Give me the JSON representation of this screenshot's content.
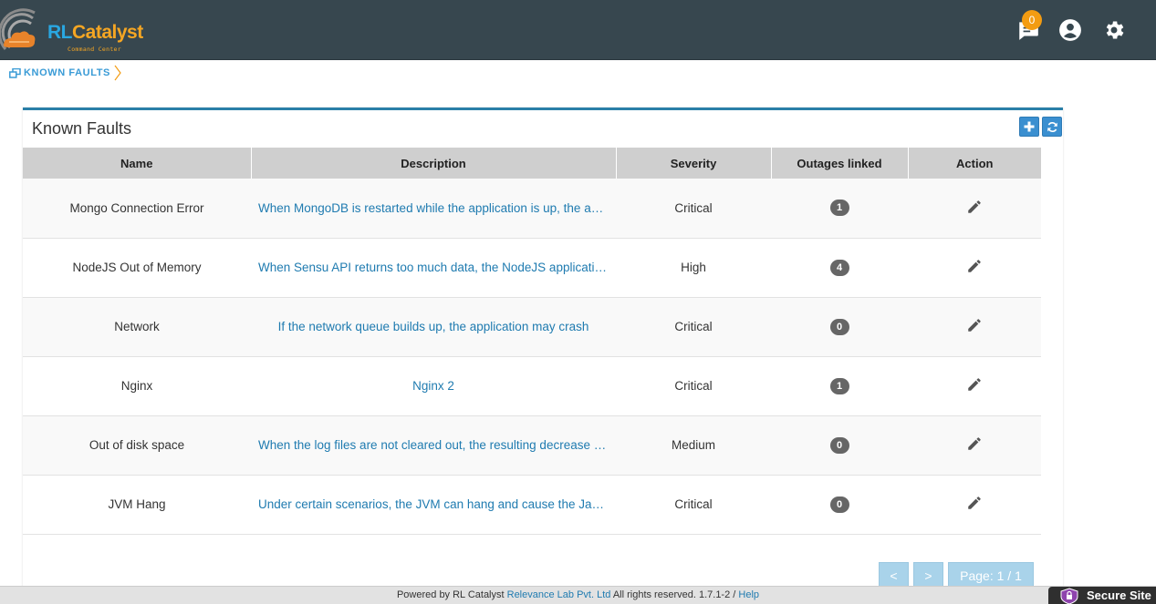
{
  "header": {
    "logo_main_1": "RL",
    "logo_main_2": "Catalyst",
    "logo_sub": "Command Center",
    "notification_count": "0",
    "icons": [
      "chat-notification-icon",
      "user-account-icon",
      "settings-gear-icon"
    ],
    "bg_color": "#37474f"
  },
  "breadcrumb": {
    "label": "KNOWN FAULTS"
  },
  "panel": {
    "title": "Known Faults",
    "add_icon": "plus-icon",
    "refresh_icon": "refresh-icon",
    "accent_color": "#2a7fa8"
  },
  "table": {
    "columns": [
      "Name",
      "Description",
      "Severity",
      "Outages linked",
      "Action"
    ],
    "rows": [
      {
        "name": "Mongo Connection Error",
        "description": "When MongoDB is restarted while the application is up, the appl...",
        "severity": "Critical",
        "outages": "1"
      },
      {
        "name": "NodeJS Out of Memory",
        "description": "When Sensu API returns too much data, the NodeJS application...",
        "severity": "High",
        "outages": "4"
      },
      {
        "name": "Network",
        "description": "If the network queue builds up, the application may crash",
        "severity": "Critical",
        "outages": "0"
      },
      {
        "name": "Nginx",
        "description": "Nginx 2",
        "severity": "Critical",
        "outages": "1"
      },
      {
        "name": "Out of disk space",
        "description": "When the log files are not cleared out, the resulting decrease in ...",
        "severity": "Medium",
        "outages": "0"
      },
      {
        "name": "JVM Hang",
        "description": "Under certain scenarios, the JVM can hang and cause the Java ...",
        "severity": "Critical",
        "outages": "0"
      }
    ]
  },
  "pagination": {
    "prev": "<",
    "next": ">",
    "page": "Page: 1 / 1"
  },
  "footer": {
    "prefix": "Powered by RL Catalyst ",
    "company": "Relevance Lab Pvt. Ltd",
    "middle": " All rights reserved. 1.7.1-2 / ",
    "help": "Help"
  },
  "secure_badge": {
    "label": "Secure Site"
  }
}
